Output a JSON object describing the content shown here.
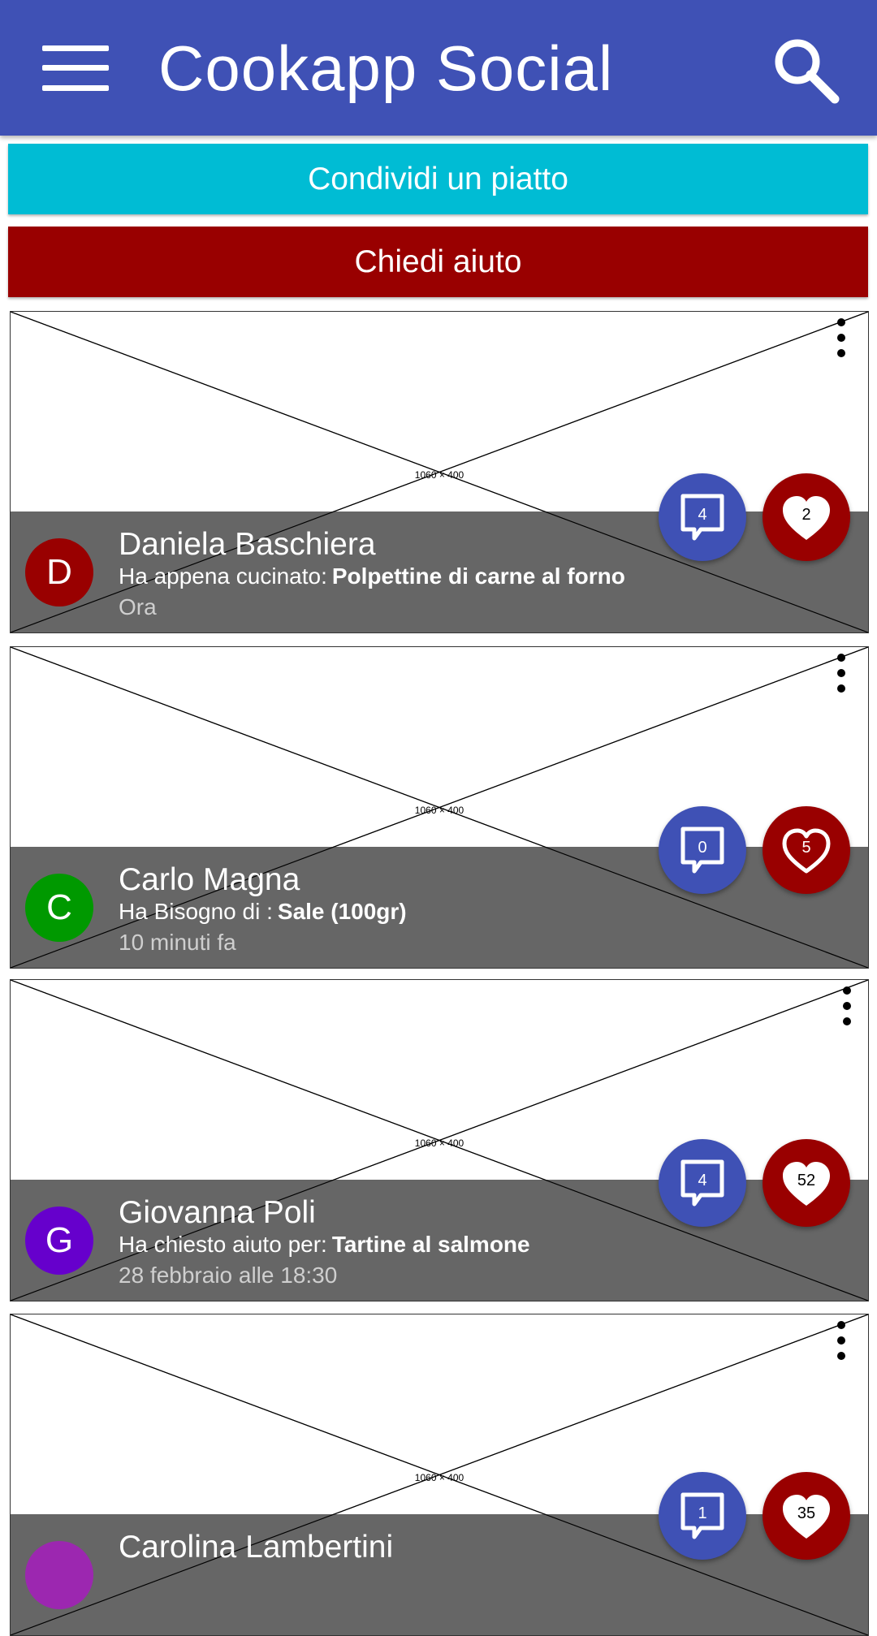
{
  "header": {
    "title": "Cookapp Social",
    "menu_icon": "hamburger-menu-icon",
    "search_icon": "search-icon",
    "color": "#3f51b5"
  },
  "actions": {
    "share_label": "Condividi un piatto",
    "share_color": "#00bcd4",
    "help_label": "Chiedi aiuto",
    "help_color": "#990000"
  },
  "posts": [
    {
      "image_label": "1060 × 400",
      "avatar_letter": "D",
      "avatar_color": "#990000",
      "author": "Daniela Baschiera",
      "action": "Ha appena cucinato:",
      "subject": "Polpettine di carne al forno",
      "time": "Ora",
      "comments": "4",
      "likes": "2"
    },
    {
      "image_label": "1060 × 400",
      "avatar_letter": "C",
      "avatar_color": "#009900",
      "author": "Carlo Magna",
      "action": "Ha Bisogno di :",
      "subject": "Sale (100gr)",
      "time": "10 minuti fa",
      "comments": "0",
      "likes": "5"
    },
    {
      "image_label": "1060 × 400",
      "avatar_letter": "G",
      "avatar_color": "#6600cc",
      "author": "Giovanna Poli",
      "action": "Ha chiesto aiuto per:",
      "subject": "Tartine al salmone",
      "time": "28 febbraio alle 18:30",
      "comments": "4",
      "likes": "52"
    },
    {
      "image_label": "1060 × 400",
      "avatar_letter": "",
      "avatar_color": "#9c27b0",
      "author": "Carolina Lambertini",
      "comments": "1",
      "likes": "35"
    }
  ]
}
